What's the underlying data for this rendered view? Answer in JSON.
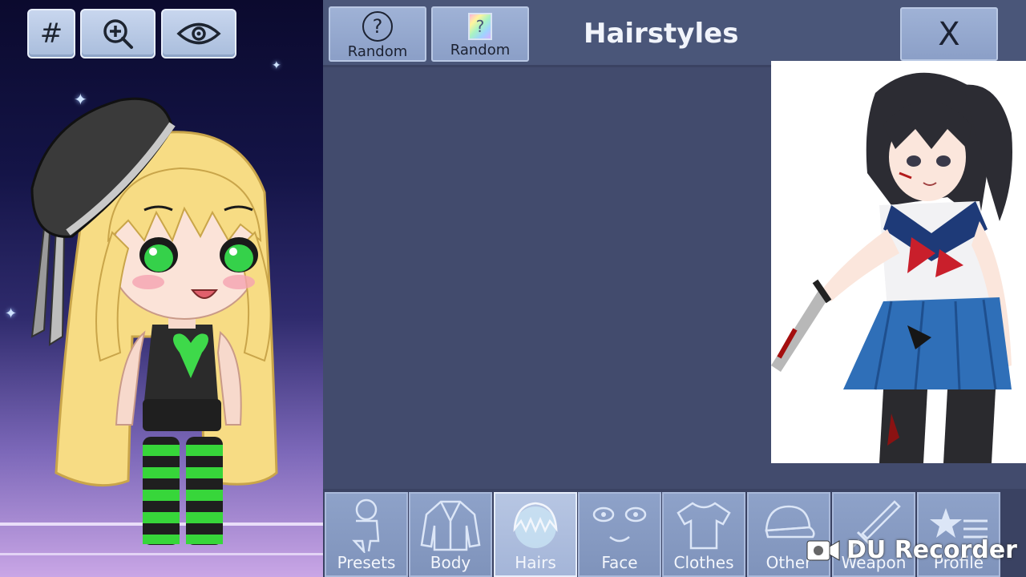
{
  "toolbar": {
    "hash_label": "#",
    "zoom_icon": "zoom-in-icon",
    "eye_icon": "eye-icon"
  },
  "header": {
    "random_buttons": [
      {
        "label": "Random",
        "icon": "question-icon"
      },
      {
        "label": "Random",
        "icon": "rainbow-question-icon"
      }
    ],
    "title": "Hairstyles",
    "close_label": "X"
  },
  "categories": [
    {
      "label": "Presets",
      "icon": "person-icon",
      "active": false
    },
    {
      "label": "Body",
      "icon": "jacket-icon",
      "active": false
    },
    {
      "label": "Hairs",
      "icon": "hair-icon",
      "active": true
    },
    {
      "label": "Face",
      "icon": "face-icon",
      "active": false
    },
    {
      "label": "Clothes",
      "icon": "shirt-icon",
      "active": false
    },
    {
      "label": "Other",
      "icon": "cap-icon",
      "active": false
    },
    {
      "label": "Weapon",
      "icon": "sword-icon",
      "active": false
    },
    {
      "label": "Profile",
      "icon": "profile-star-icon",
      "active": false
    }
  ],
  "watermark": {
    "text": "DU Recorder",
    "icon": "camera-icon"
  },
  "colors": {
    "panel_bg": "#424b6d",
    "topbar_bg": "#4a5679",
    "button_bg": "#9fb2d6",
    "text_dark": "#1c2232",
    "text_light": "#f1f4fb",
    "character_hair": "#f7dc84",
    "character_eyes": "#35d14a",
    "character_beret": "#3a3a3a"
  }
}
